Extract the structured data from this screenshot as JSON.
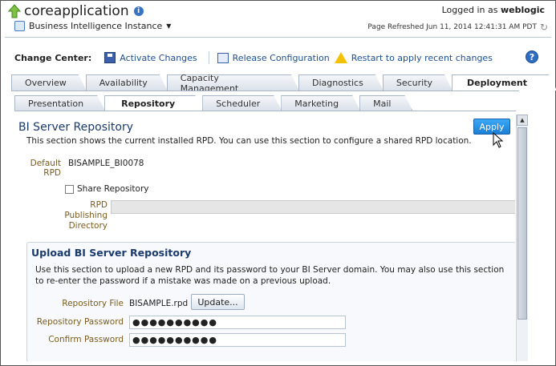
{
  "header": {
    "app_name": "coreapplication",
    "instance_label": "Business Intelligence Instance",
    "logged_in_prefix": "Logged in as",
    "user": "weblogic",
    "page_refreshed": "Page Refreshed Jun 11, 2014 12:41:31 AM PDT"
  },
  "change_center": {
    "label": "Change Center:",
    "activate": "Activate Changes",
    "release": "Release Configuration",
    "restart": "Restart to apply recent changes"
  },
  "tabs": [
    {
      "label": "Overview"
    },
    {
      "label": "Availability"
    },
    {
      "label": "Capacity Management"
    },
    {
      "label": "Diagnostics"
    },
    {
      "label": "Security"
    },
    {
      "label": "Deployment"
    }
  ],
  "subtabs": [
    {
      "label": "Presentation"
    },
    {
      "label": "Repository"
    },
    {
      "label": "Scheduler"
    },
    {
      "label": "Marketing"
    },
    {
      "label": "Mail"
    }
  ],
  "repository": {
    "title": "BI Server Repository",
    "description": "This section shows the current installed RPD. You can use this section to configure a shared RPD location.",
    "apply_label": "Apply",
    "default_rpd_label_1": "Default",
    "default_rpd_label_2": "RPD",
    "default_rpd_value": "BISAMPLE_BI0078",
    "share_label": "Share Repository",
    "publish_dir_label_1": "RPD",
    "publish_dir_label_2": "Publishing",
    "publish_dir_label_3": "Directory"
  },
  "upload": {
    "title": "Upload BI Server Repository",
    "description": "Use this section to upload a new RPD and its password to your BI Server domain. You may also use this section to re-enter the password if a mistake was made on a previous upload.",
    "file_label": "Repository File",
    "file_value": "BISAMPLE.rpd",
    "update_label": "Update...",
    "password_label": "Repository Password",
    "password_value": "●●●●●●●●●●",
    "confirm_label": "Confirm Password",
    "confirm_value": "●●●●●●●●●●"
  },
  "colors": {
    "accent": "#1b7fd6",
    "title": "#1b3b6f",
    "label": "#7a5c1e"
  }
}
